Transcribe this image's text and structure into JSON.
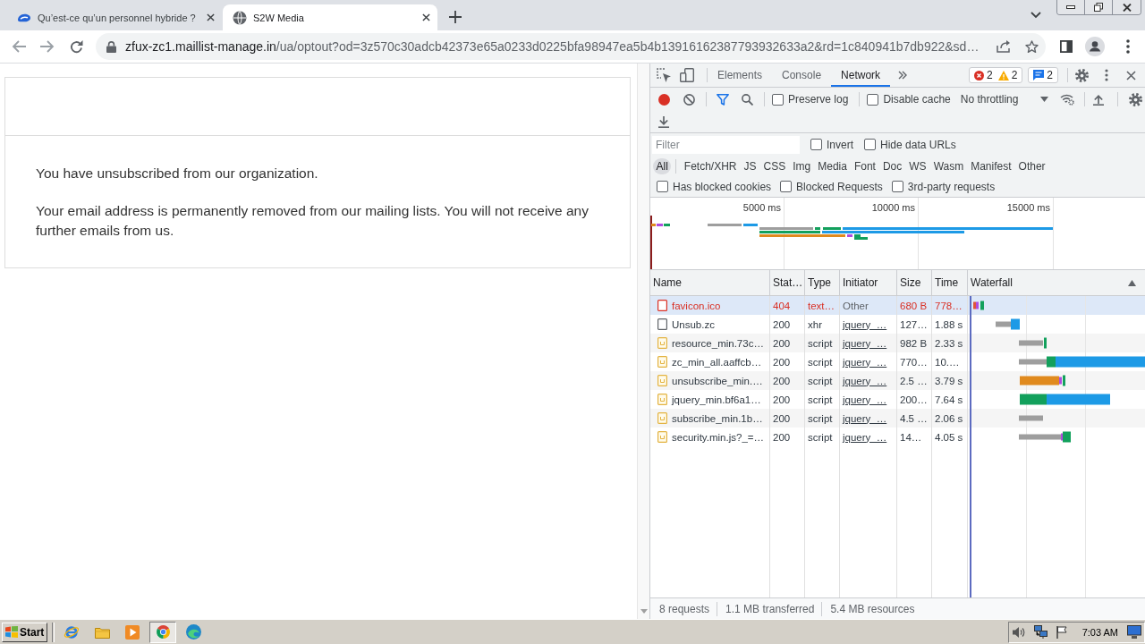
{
  "browser_tabs": [
    {
      "title": "Qu’est-ce qu’un personnel hybride ?",
      "selected": false
    },
    {
      "title": "S2W Media",
      "selected": true
    }
  ],
  "address_bar": {
    "host": "zfux-zc1.maillist-manage.in",
    "path": "/ua/optout?od=3z570c30adcb42373e65a0233d0225bfa98947ea5b4b13916162387793932633a2&rd=1c840941b7db922&sd…"
  },
  "page": {
    "paragraphs": [
      "You have unsubscribed from our organization.",
      "Your email address is permanently removed from our mailing lists. You will not receive any further emails from us."
    ]
  },
  "devtools": {
    "panel_tabs": [
      {
        "label": "Elements",
        "selected": false
      },
      {
        "label": "Console",
        "selected": false
      },
      {
        "label": "Network",
        "selected": true
      }
    ],
    "issues": {
      "errors": "2",
      "warnings": "2",
      "messages": "2"
    },
    "recording": true,
    "toolbar_options": [
      {
        "label": "Preserve log",
        "checked": false
      },
      {
        "label": "Disable cache",
        "checked": false
      }
    ],
    "throttling": "No throttling",
    "filter": {
      "placeholder": "Filter",
      "options": [
        {
          "label": "Invert",
          "checked": false
        },
        {
          "label": "Hide data URLs",
          "checked": false
        }
      ]
    },
    "type_filters": [
      {
        "label": "All",
        "selected": true
      },
      {
        "label": "Fetch/XHR",
        "selected": false
      },
      {
        "label": "JS",
        "selected": false
      },
      {
        "label": "CSS",
        "selected": false
      },
      {
        "label": "Img",
        "selected": false
      },
      {
        "label": "Media",
        "selected": false
      },
      {
        "label": "Font",
        "selected": false
      },
      {
        "label": "Doc",
        "selected": false
      },
      {
        "label": "WS",
        "selected": false
      },
      {
        "label": "Wasm",
        "selected": false
      },
      {
        "label": "Manifest",
        "selected": false
      },
      {
        "label": "Other",
        "selected": false
      }
    ],
    "request_filters": [
      {
        "label": "Has blocked cookies",
        "checked": false
      },
      {
        "label": "Blocked Requests",
        "checked": false
      },
      {
        "label": "3rd-party requests",
        "checked": false
      }
    ],
    "overview_ticks": [
      "5000 ms",
      "10000 ms",
      "15000 ms"
    ],
    "table": {
      "columns": [
        "Name",
        "Stat…",
        "Type",
        "Initiator",
        "Size",
        "Time",
        "Waterfall"
      ],
      "rows": [
        {
          "name": "favicon.ico",
          "kind": "document",
          "error": true,
          "selected": true,
          "status": "404",
          "type": "text…",
          "initiator": "Other",
          "initiator_link": false,
          "size": "680 B",
          "time": "778…"
        },
        {
          "name": "Unsub.zc",
          "kind": "document",
          "error": false,
          "selected": false,
          "status": "200",
          "type": "xhr",
          "initiator": "jquery_…",
          "initiator_link": true,
          "size": "127…",
          "time": "1.88 s"
        },
        {
          "name": "resource_min.73c…",
          "kind": "script",
          "error": false,
          "selected": false,
          "status": "200",
          "type": "script",
          "initiator": "jquery_…",
          "initiator_link": true,
          "size": "982 B",
          "time": "2.33 s"
        },
        {
          "name": "zc_min_all.aaffcb…",
          "kind": "script",
          "error": false,
          "selected": false,
          "status": "200",
          "type": "script",
          "initiator": "jquery_…",
          "initiator_link": true,
          "size": "770…",
          "time": "10.…"
        },
        {
          "name": "unsubscribe_min.…",
          "kind": "script",
          "error": false,
          "selected": false,
          "status": "200",
          "type": "script",
          "initiator": "jquery_…",
          "initiator_link": true,
          "size": "2.5 …",
          "time": "3.79 s"
        },
        {
          "name": "jquery_min.bf6a1…",
          "kind": "script",
          "error": false,
          "selected": false,
          "status": "200",
          "type": "script",
          "initiator": "jquery_…",
          "initiator_link": true,
          "size": "200…",
          "time": "7.64 s"
        },
        {
          "name": "subscribe_min.1b…",
          "kind": "script",
          "error": false,
          "selected": false,
          "status": "200",
          "type": "script",
          "initiator": "jquery_…",
          "initiator_link": true,
          "size": "4.5 …",
          "time": "2.06 s"
        },
        {
          "name": "security.min.js?_=…",
          "kind": "script",
          "error": false,
          "selected": false,
          "status": "200",
          "type": "script",
          "initiator": "jquery_…",
          "initiator_link": true,
          "size": "14…",
          "time": "4.05 s"
        }
      ]
    },
    "summary": [
      "8 requests",
      "1.1 MB transferred",
      "5.4 MB resources"
    ]
  },
  "taskbar": {
    "start": "Start",
    "apps": [
      {
        "kind": "ie",
        "selected": false
      },
      {
        "kind": "folder",
        "selected": false
      },
      {
        "kind": "media",
        "selected": false
      },
      {
        "kind": "chrome",
        "selected": true
      },
      {
        "kind": "edge",
        "selected": false
      }
    ],
    "clock": "7:03 AM"
  }
}
